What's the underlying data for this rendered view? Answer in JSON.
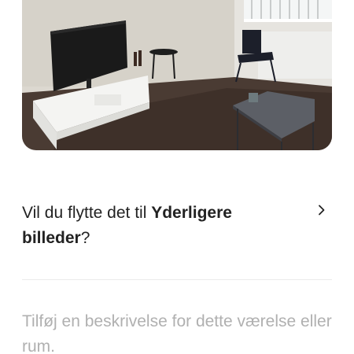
{
  "photo": {
    "icon": "room-photo",
    "colors": {
      "wall": "#dcd8d0",
      "floor": "#4a3b33",
      "furniture": "#f4f4f2",
      "tv": "#1a1a1a"
    }
  },
  "move_prompt": {
    "prefix": "Vil du flytte det til",
    "target": "Yderligere billeder",
    "suffix": "?",
    "icon": "chevron-right-icon"
  },
  "description": {
    "placeholder": "Tilføj en beskrivelse for dette værelse eller rum."
  }
}
